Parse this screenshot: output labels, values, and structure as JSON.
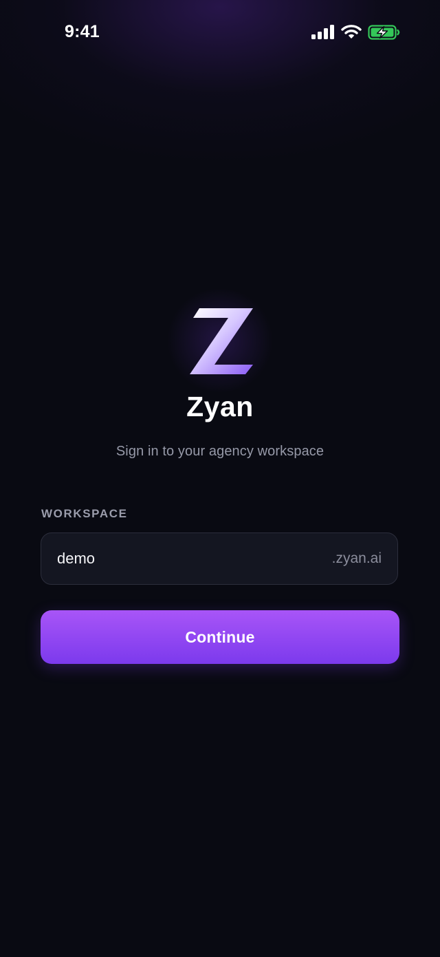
{
  "status_bar": {
    "time": "9:41",
    "icons": [
      "signal-icon",
      "wifi-icon",
      "battery-charging-icon"
    ]
  },
  "brand": {
    "logo": "zyan-logo",
    "name": "Zyan",
    "tagline": "Sign in to your agency workspace"
  },
  "form": {
    "workspace_label": "WORKSPACE",
    "workspace_value": "demo",
    "workspace_suffix": ".zyan.ai",
    "continue_label": "Continue"
  },
  "colors": {
    "background": "#090a12",
    "accent_start": "#a855f7",
    "accent_end": "#7c3aed",
    "battery": "#34c759",
    "field_background": "#141621"
  }
}
